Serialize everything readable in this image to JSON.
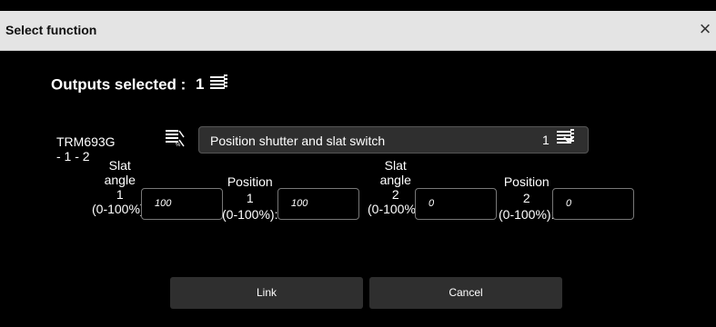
{
  "dialog": {
    "title": "Select function",
    "close_icon": "close-icon"
  },
  "outputs": {
    "label": "Outputs selected :",
    "count": "1",
    "icon": "stacked-outputs-icon"
  },
  "device_row": {
    "device_label": "TRM693G - 1 - 2",
    "device_icon": "shutter-percent-icon",
    "function_value": "Position shutter and slat switch",
    "function_dropdown_icon": "chevron-down-icon",
    "count": "1",
    "count_icon": "stacked-outputs-icon"
  },
  "params": [
    {
      "label_lines": [
        "Slat",
        "angle",
        "1",
        "(0-100%):"
      ],
      "value": "100"
    },
    {
      "label_lines": [
        "Position",
        "1",
        "(0-100%):"
      ],
      "value": "100"
    },
    {
      "label_lines": [
        "Slat",
        "angle",
        "2",
        "(0-100%):"
      ],
      "value": "0"
    },
    {
      "label_lines": [
        "Position",
        "2",
        "(0-100%):"
      ],
      "value": "0"
    }
  ],
  "buttons": {
    "link": "Link",
    "cancel": "Cancel"
  }
}
